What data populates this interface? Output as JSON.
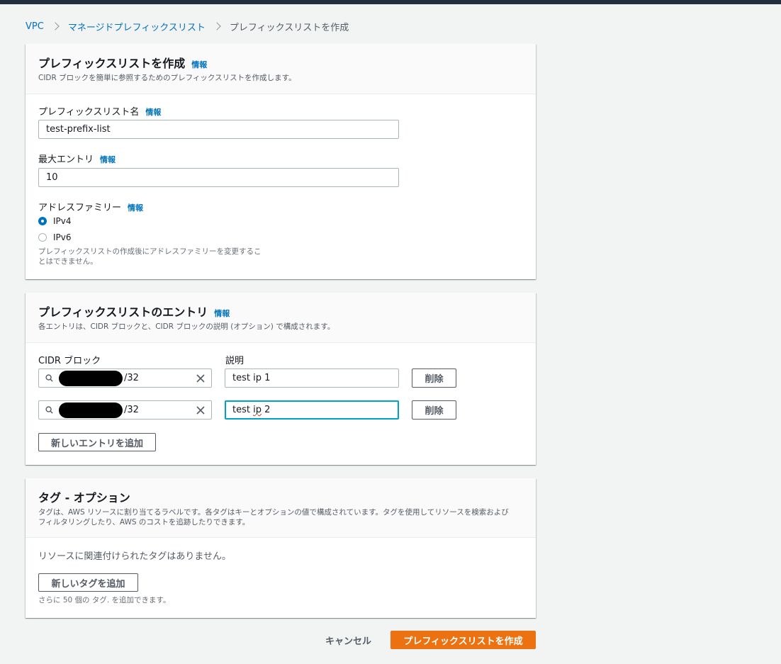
{
  "breadcrumb": {
    "items": [
      "VPC",
      "マネージドプレフィックスリスト"
    ],
    "current": "プレフィックスリストを作成"
  },
  "info_label": "情報",
  "details": {
    "title": "プレフィックスリストを作成",
    "description": "CIDR ブロックを簡単に参照するためのプレフィックスリストを作成します。",
    "name_label": "プレフィックスリスト名",
    "name_value": "test-prefix-list",
    "max_entries_label": "最大エントリ",
    "max_entries_value": "10",
    "address_family_label": "アドレスファミリー",
    "ipv4_label": "IPv4",
    "ipv6_label": "IPv6",
    "selected_family": "IPv4",
    "address_family_hint_line1": "プレフィックスリストの作成後にアドレスファミリーを変更するこ",
    "address_family_hint_line2": "とはできません。"
  },
  "entries": {
    "title": "プレフィックスリストのエントリ",
    "description": "各エントリは、CIDR ブロックと、CIDR ブロックの説明 (オプション) で構成されます。",
    "cidr_label": "CIDR ブロック",
    "desc_label": "説明",
    "rows": [
      {
        "cidr_suffix": "/32",
        "description": "test ip 1",
        "remove_label": "削除"
      },
      {
        "cidr_suffix": "/32",
        "description_pre": "test ",
        "description_err": "ip",
        "description_post": " 2",
        "remove_label": "削除"
      }
    ],
    "add_entry_label": "新しいエントリを追加"
  },
  "tags": {
    "title": "タグ - オプション",
    "description_line1": "タグは、AWS リソースに割り当てるラベルです。各タグはキーとオプションの値で構成されています。タグを使用してリソースを検索および",
    "description_line2": "フィルタリングしたり、AWS のコストを追跡したりできます。",
    "empty_text": "リソースに関連付けられたタグはありません。",
    "add_tag_label": "新しいタグを追加",
    "remaining_hint": "さらに 50 個の タグ. を追加できます。"
  },
  "footer": {
    "cancel_label": "キャンセル",
    "create_label": "プレフィックスリストを作成"
  },
  "colors": {
    "primary": "#ec7211",
    "link": "#0073bb",
    "focus": "#00a1c9"
  }
}
